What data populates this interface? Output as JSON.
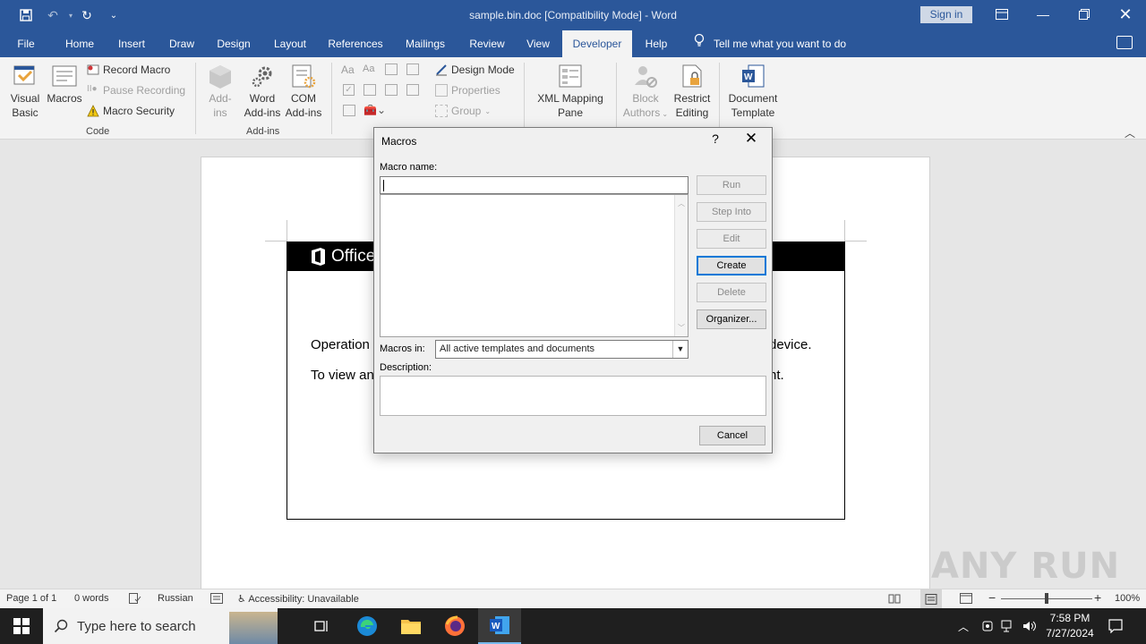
{
  "window": {
    "title": "sample.bin.doc [Compatibility Mode]  -  Word",
    "sign_in": "Sign in"
  },
  "ribbon_tabs": [
    "File",
    "Home",
    "Insert",
    "Draw",
    "Design",
    "Layout",
    "References",
    "Mailings",
    "Review",
    "View",
    "Developer",
    "Help"
  ],
  "active_tab": "Developer",
  "tell_me": "Tell me what you want to do",
  "ribbon": {
    "code": {
      "visual_basic": [
        "Visual",
        "Basic"
      ],
      "macros": "Macros",
      "record_macro": "Record Macro",
      "pause_recording": "Pause Recording",
      "macro_security": "Macro Security",
      "label": "Code"
    },
    "addins": {
      "addins": [
        "Add-",
        "ins"
      ],
      "word_addins": [
        "Word",
        "Add-ins"
      ],
      "com_addins": [
        "COM",
        "Add-ins"
      ],
      "label": "Add-ins"
    },
    "controls": {
      "design_mode": "Design Mode",
      "properties": "Properties",
      "group": "Group"
    },
    "mapping": {
      "xml_mapping_pane": [
        "XML Mapping",
        "Pane"
      ]
    },
    "protect": {
      "block_authors": [
        "Block",
        "Authors"
      ],
      "restrict_editing": [
        "Restrict",
        "Editing"
      ]
    },
    "templates": {
      "document_template": [
        "Document",
        "Template"
      ]
    }
  },
  "document": {
    "banner_text": "Office",
    "line1_left": "Operation",
    "line1_right": "device.",
    "line2_left": "To view an",
    "line2_right": "nt."
  },
  "dialog": {
    "title": "Macros",
    "help": "?",
    "macro_name_label": "Macro name:",
    "macro_name_value": "",
    "buttons": {
      "run": "Run",
      "step_into": "Step Into",
      "edit": "Edit",
      "create": "Create",
      "delete": "Delete",
      "organizer": "Organizer..."
    },
    "macros_in_label": "Macros in:",
    "macros_in_value": "All active templates and documents",
    "description_label": "Description:",
    "cancel": "Cancel"
  },
  "statusbar": {
    "page": "Page 1 of 1",
    "words": "0 words",
    "language": "Russian",
    "accessibility": "Accessibility: Unavailable",
    "zoom": "100%"
  },
  "taskbar": {
    "search_placeholder": "Type here to search",
    "time": "7:58 PM",
    "date": "7/27/2024"
  },
  "watermark": "ANY RUN",
  "colors": {
    "word_blue": "#2b579a",
    "default_button_border": "#0078d7"
  }
}
